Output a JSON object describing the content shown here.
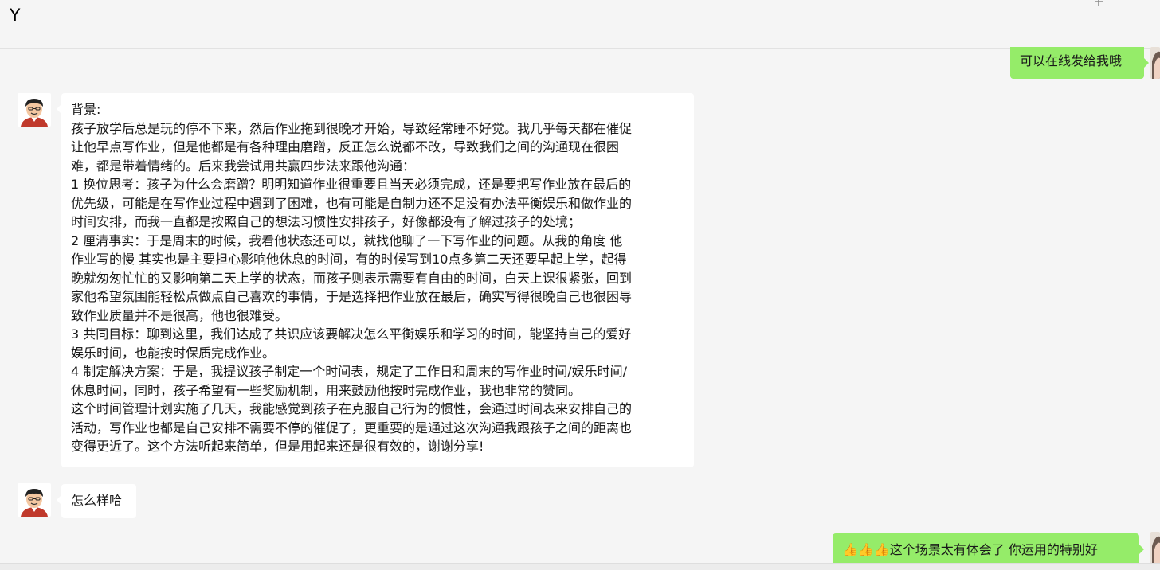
{
  "header": {
    "title": "Y"
  },
  "messages": {
    "m1": {
      "text": "可以在线发给我哦"
    },
    "m2": {
      "lines": [
        "背景:",
        "孩子放学后总是玩的停不下来，然后作业拖到很晚才开始，导致经常睡不好觉。我几乎每天都在催促",
        "让他早点写作业，但是他都是有各种理由磨蹭，反正怎么说都不改，导致我们之间的沟通现在很困",
        "难，都是带着情绪的。后来我尝试用共赢四步法来跟他沟通：",
        "1 换位思考：孩子为什么会磨蹭？明明知道作业很重要且当天必须完成，还是要把写作业放在最后的",
        "优先级，可能是在写作业过程中遇到了困难，也有可能是自制力还不足没有办法平衡娱乐和做作业的",
        "时间安排，而我一直都是按照自己的想法习惯性安排孩子，好像都没有了解过孩子的处境；",
        "2 厘清事实：于是周末的时候，我看他状态还可以，就找他聊了一下写作业的问题。从我的角度 他",
        "作业写的慢 其实也是主要担心影响他休息的时间，有的时候写到10点多第二天还要早起上学，起得",
        "晚就匆匆忙忙的又影响第二天上学的状态，而孩子则表示需要有自由的时间，白天上课很紧张，回到",
        "家他希望氛围能轻松点做点自己喜欢的事情，于是选择把作业放在最后，确实写得很晚自己也很困导",
        "致作业质量并不是很高，他也很难受。",
        "3 共同目标：聊到这里，我们达成了共识应该要解决怎么平衡娱乐和学习的时间，能坚持自己的爱好",
        "娱乐时间，也能按时保质完成作业。",
        "4 制定解决方案：于是，我提议孩子制定一个时间表，规定了工作日和周末的写作业时间/娱乐时间/",
        "休息时间，同时，孩子希望有一些奖励机制，用来鼓励他按时完成作业，我也非常的赞同。",
        "这个时间管理计划实施了几天，我能感觉到孩子在克服自己行为的惯性，会通过时间表来安排自己的",
        "活动，写作业也都是自己安排不需要不停的催促了，更重要的是通过这次沟通我跟孩子之间的距离也",
        "变得更近了。这个方法听起来简单，但是用起来还是很有效的，谢谢分享!"
      ]
    },
    "m3": {
      "text": "怎么样哈"
    },
    "m4": {
      "emoji": "👍👍👍",
      "text": "这个场景太有体会了 你运用的特别好"
    }
  },
  "colors": {
    "bg": "#f5f5f5",
    "bubble_left": "#ffffff",
    "bubble_right": "#95ec69"
  }
}
